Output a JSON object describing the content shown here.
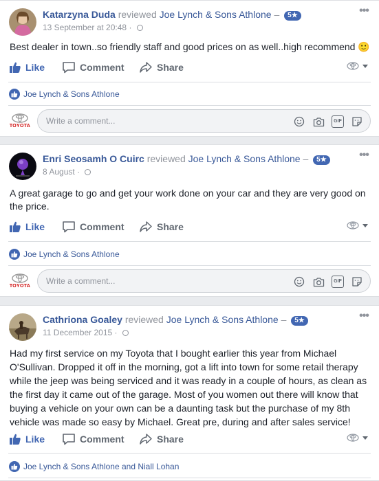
{
  "colors": {
    "accent": "#4267b2",
    "link": "#385898",
    "muted": "#90949c"
  },
  "posts": [
    {
      "author": "Katarzyna Duda",
      "verb": "reviewed",
      "page": "Joe Lynch & Sons Athlone",
      "dash": "–",
      "rating": "5★",
      "date": "13 September at 20:48",
      "dot": "·",
      "text": "Best dealer in town..so friendly staff and good prices on as well..high recommend 🙂",
      "likes": "Joe Lynch & Sons Athlone"
    },
    {
      "author": "Enri Seosamh O Cuirc",
      "verb": "reviewed",
      "page": "Joe Lynch & Sons Athlone",
      "dash": "–",
      "rating": "5★",
      "date": "8 August",
      "dot": "·",
      "text": "A great garage to go and get your work done on your car and they are very good on the price.",
      "likes": "Joe Lynch & Sons Athlone"
    },
    {
      "author": "Cathriona Goaley",
      "verb": "reviewed",
      "page": "Joe Lynch & Sons Athlone",
      "dash": "–",
      "rating": "5★",
      "date": "11 December 2015",
      "dot": "·",
      "text": "Had my first service on my Toyota that I bought earlier this year from Michael O'Sullivan. Dropped it off in the morning, got a lift into town for some retail therapy while the jeep was being serviced and it was ready in a couple of hours, as clean as the first day it came out of the garage. Most of you women out there will know that buying a vehicle on your own can be a daunting task but the purchase of my 8th vehicle was made so easy by Michael. Great pre, during and after sales service!",
      "likes": "Joe Lynch & Sons Athlone and Niall Lohan"
    }
  ],
  "actions": {
    "like": "Like",
    "comment": "Comment",
    "share": "Share"
  },
  "comment": {
    "placeholder": "Write a comment...",
    "brand": "TOYOTA",
    "gif": "GIF"
  },
  "menu": {
    "more": "•••"
  },
  "icons": [
    "like-thumb-icon",
    "comment-bubble-icon",
    "share-arrow-icon",
    "emoji-icon",
    "camera-icon",
    "gif-icon",
    "sticker-icon",
    "toyota-logo",
    "globe-icon",
    "more-icon",
    "caret-down-icon"
  ]
}
